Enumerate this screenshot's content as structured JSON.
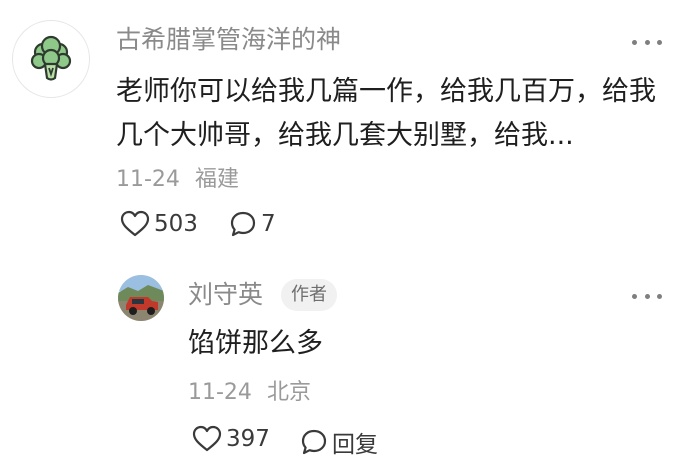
{
  "comment": {
    "username": "古希腊掌管海洋的神",
    "text": "老师你可以给我几篇一作，给我几百万，给我几个大帅哥，给我几套大别墅，给我...",
    "date": "11-24",
    "location": "福建",
    "likes": "503",
    "comments": "7",
    "avatar_icon": "broccoli-icon",
    "more_icon": "more-dots-icon"
  },
  "reply": {
    "username": "刘守英",
    "badge": "作者",
    "text": "馅饼那么多",
    "date": "11-24",
    "location": "北京",
    "likes": "397",
    "reply_label": "回复",
    "avatar_icon": "red-jeep-avatar",
    "more_icon": "more-dots-icon"
  },
  "colors": {
    "username": "#8a8a8a",
    "body_text": "#1f1f1f",
    "meta_text": "#9a9a9a",
    "badge_bg": "#f1f1f1"
  }
}
